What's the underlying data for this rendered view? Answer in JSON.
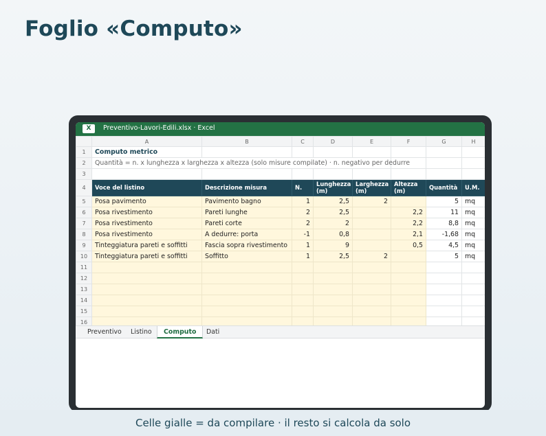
{
  "page": {
    "title": "Foglio «Computo»",
    "footer": "Celle gialle = da compilare · il resto si calcola da solo"
  },
  "window": {
    "app_badge": "X",
    "filename": "Preventivo-Lavori-Edili.xlsx · Excel"
  },
  "sheet": {
    "columns": [
      "A",
      "B",
      "C",
      "D",
      "E",
      "F",
      "G",
      "H"
    ],
    "row_numbers": [
      "1",
      "2",
      "3",
      "4",
      "5",
      "6",
      "7",
      "8",
      "9",
      "10",
      "11",
      "12",
      "13",
      "14",
      "15",
      "16"
    ],
    "title": "Computo metrico",
    "note": "Quantità = n. x lunghezza x larghezza x altezza (solo misure compilate) · n. negativo per dedurre",
    "headers": {
      "voce": "Voce del listino",
      "descrizione": "Descrizione misura",
      "n": "N.",
      "lunghezza": "Lunghezza (m)",
      "larghezza": "Larghezza (m)",
      "altezza": "Altezza (m)",
      "quantita": "Quantità",
      "um": "U.M."
    },
    "rows": [
      {
        "voce": "Posa pavimento",
        "descrizione": "Pavimento bagno",
        "n": "1",
        "lunghezza": "2,5",
        "larghezza": "2",
        "altezza": "",
        "quantita": "5",
        "um": "mq"
      },
      {
        "voce": "Posa rivestimento",
        "descrizione": "Pareti lunghe",
        "n": "2",
        "lunghezza": "2,5",
        "larghezza": "",
        "altezza": "2,2",
        "quantita": "11",
        "um": "mq"
      },
      {
        "voce": "Posa rivestimento",
        "descrizione": "Pareti corte",
        "n": "2",
        "lunghezza": "2",
        "larghezza": "",
        "altezza": "2,2",
        "quantita": "8,8",
        "um": "mq"
      },
      {
        "voce": "Posa rivestimento",
        "descrizione": "A dedurre: porta",
        "n": "-1",
        "lunghezza": "0,8",
        "larghezza": "",
        "altezza": "2,1",
        "quantita": "-1,68",
        "um": "mq"
      },
      {
        "voce": "Tinteggiatura pareti e soffitti",
        "descrizione": "Fascia sopra rivestimento",
        "n": "1",
        "lunghezza": "9",
        "larghezza": "",
        "altezza": "0,5",
        "quantita": "4,5",
        "um": "mq"
      },
      {
        "voce": "Tinteggiatura pareti e soffitti",
        "descrizione": "Soffitto",
        "n": "1",
        "lunghezza": "2,5",
        "larghezza": "2",
        "altezza": "",
        "quantita": "5",
        "um": "mq"
      }
    ]
  },
  "tabs": [
    "Preventivo",
    "Listino",
    "Computo",
    "Dati"
  ],
  "active_tab": "Computo",
  "colors": {
    "excel_green": "#237244",
    "header_blue": "#1f4858",
    "input_yellow": "#fff7dd",
    "title_text": "#1e4858"
  }
}
